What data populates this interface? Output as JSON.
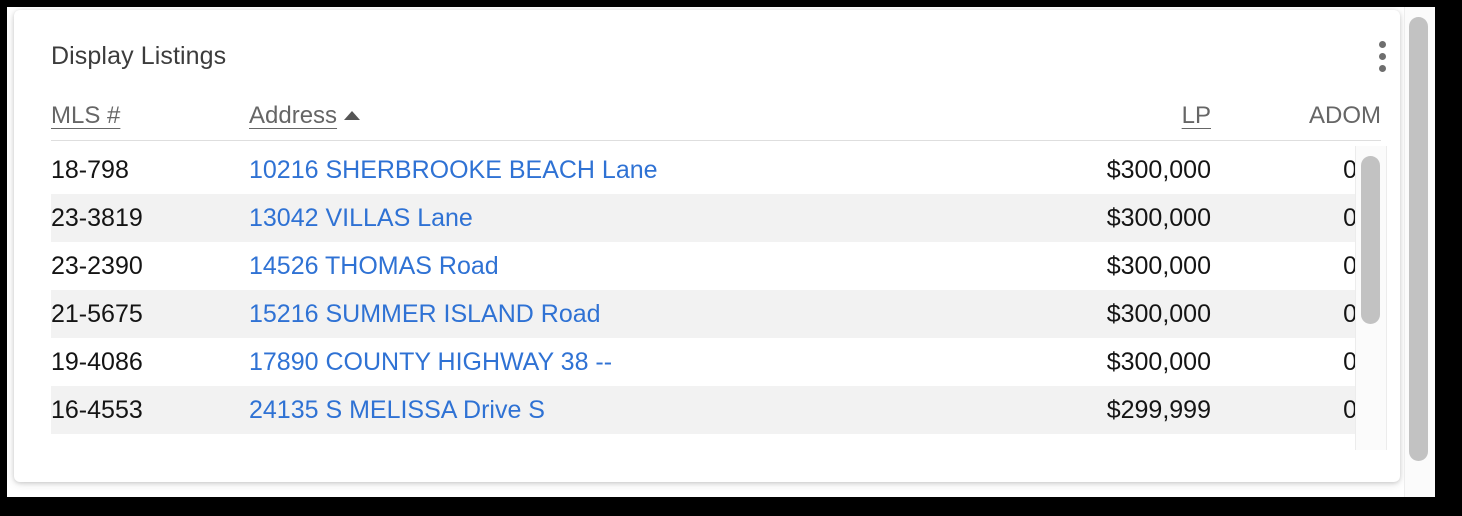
{
  "panel": {
    "title": "Display Listings",
    "menu_icon": "kebab-menu-icon"
  },
  "table": {
    "columns": [
      {
        "key": "mls",
        "label": "MLS #",
        "sortable": true,
        "sorted": false,
        "align": "left"
      },
      {
        "key": "address",
        "label": "Address",
        "sortable": true,
        "sorted": true,
        "sort_direction": "asc",
        "sort_glyph": "▲",
        "align": "left"
      },
      {
        "key": "lp",
        "label": "LP",
        "sortable": true,
        "sorted": false,
        "align": "right"
      },
      {
        "key": "adom",
        "label": "ADOM",
        "sortable": false,
        "sorted": false,
        "align": "right"
      }
    ],
    "rows": [
      {
        "mls": "18-798",
        "address": "10216 SHERBROOKE BEACH Lane",
        "lp": "$300,000",
        "adom": "0"
      },
      {
        "mls": "23-3819",
        "address": "13042 VILLAS Lane",
        "lp": "$300,000",
        "adom": "0"
      },
      {
        "mls": "23-2390",
        "address": "14526 THOMAS Road",
        "lp": "$300,000",
        "adom": "0"
      },
      {
        "mls": "21-5675",
        "address": "15216 SUMMER ISLAND Road",
        "lp": "$300,000",
        "adom": "0"
      },
      {
        "mls": "19-4086",
        "address": "17890 COUNTY HIGHWAY 38 --",
        "lp": "$300,000",
        "adom": "0"
      },
      {
        "mls": "16-4553",
        "address": "24135 S MELISSA Drive S",
        "lp": "$299,999",
        "adom": "0"
      }
    ]
  },
  "colors": {
    "link": "#2f72d4",
    "header_text": "#666666",
    "title_text": "#3c3c3c",
    "row_text": "#141414",
    "row_stripe": "#f2f2f2",
    "scrollbar_thumb": "#c2c2c2"
  }
}
